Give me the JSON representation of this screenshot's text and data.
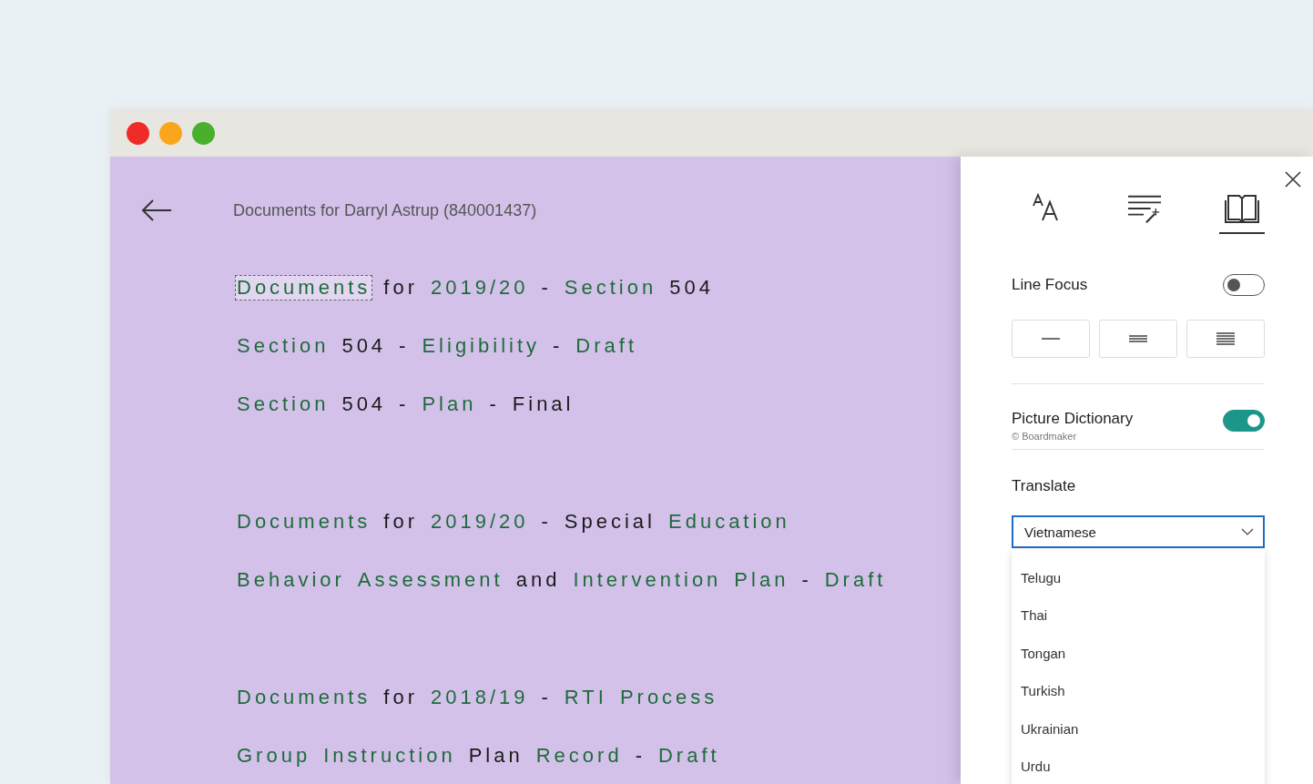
{
  "heading": "Documents for Darryl Astrup (840001437)",
  "groups": [
    [
      {
        "words": [
          {
            "text": "Documents",
            "color": "#1e6b3a",
            "focused": true
          },
          {
            "text": "for",
            "color": "#1a1a1a",
            "focused": false
          },
          {
            "text": "2019/20",
            "color": "#1e6b3a",
            "focused": false
          },
          {
            "text": "-",
            "color": "#1a1a1a",
            "focused": false
          },
          {
            "text": "Section",
            "color": "#1e6b3a",
            "focused": false
          },
          {
            "text": "504",
            "color": "#1a1a1a",
            "focused": false
          }
        ]
      },
      {
        "words": [
          {
            "text": "Section",
            "color": "#1e6b3a",
            "focused": false
          },
          {
            "text": "504",
            "color": "#1a1a1a",
            "focused": false
          },
          {
            "text": "-",
            "color": "#1a1a1a",
            "focused": false
          },
          {
            "text": "Eligibility",
            "color": "#1e6b3a",
            "focused": false
          },
          {
            "text": "-",
            "color": "#1a1a1a",
            "focused": false
          },
          {
            "text": "Draft",
            "color": "#1e6b3a",
            "focused": false
          }
        ]
      },
      {
        "words": [
          {
            "text": "Section",
            "color": "#1e6b3a",
            "focused": false
          },
          {
            "text": "504",
            "color": "#1a1a1a",
            "focused": false
          },
          {
            "text": "-",
            "color": "#1a1a1a",
            "focused": false
          },
          {
            "text": "Plan",
            "color": "#1e6b3a",
            "focused": false
          },
          {
            "text": "-",
            "color": "#1a1a1a",
            "focused": false
          },
          {
            "text": "Final",
            "color": "#1a1a1a",
            "focused": false
          }
        ]
      }
    ],
    [
      {
        "words": [
          {
            "text": "Documents",
            "color": "#1e6b3a",
            "focused": false
          },
          {
            "text": "for",
            "color": "#1a1a1a",
            "focused": false
          },
          {
            "text": "2019/20",
            "color": "#1e6b3a",
            "focused": false
          },
          {
            "text": "-",
            "color": "#1a1a1a",
            "focused": false
          },
          {
            "text": "Special",
            "color": "#1a1a1a",
            "focused": false
          },
          {
            "text": "Education",
            "color": "#1e6b3a",
            "focused": false
          }
        ]
      },
      {
        "words": [
          {
            "text": "Behavior",
            "color": "#1e6b3a",
            "focused": false
          },
          {
            "text": "Assessment",
            "color": "#1e6b3a",
            "focused": false
          },
          {
            "text": "and",
            "color": "#1a1a1a",
            "focused": false
          },
          {
            "text": "Intervention",
            "color": "#1e6b3a",
            "focused": false
          },
          {
            "text": "Plan",
            "color": "#1e6b3a",
            "focused": false
          },
          {
            "text": "-",
            "color": "#1a1a1a",
            "focused": false
          },
          {
            "text": "Draft",
            "color": "#1e6b3a",
            "focused": false
          }
        ]
      }
    ],
    [
      {
        "words": [
          {
            "text": "Documents",
            "color": "#1e6b3a",
            "focused": false
          },
          {
            "text": "for",
            "color": "#1a1a1a",
            "focused": false
          },
          {
            "text": "2018/19",
            "color": "#1e6b3a",
            "focused": false
          },
          {
            "text": "-",
            "color": "#1a1a1a",
            "focused": false
          },
          {
            "text": "RTI",
            "color": "#1e6b3a",
            "focused": false
          },
          {
            "text": "Process",
            "color": "#1e6b3a",
            "focused": false
          }
        ]
      },
      {
        "words": [
          {
            "text": "Group",
            "color": "#1e6b3a",
            "focused": false
          },
          {
            "text": "Instruction",
            "color": "#1e6b3a",
            "focused": false
          },
          {
            "text": "Plan",
            "color": "#1a1a1a",
            "focused": false
          },
          {
            "text": "Record",
            "color": "#1e6b3a",
            "focused": false
          },
          {
            "text": "-",
            "color": "#1a1a1a",
            "focused": false
          },
          {
            "text": "Draft",
            "color": "#1e6b3a",
            "focused": false
          }
        ]
      }
    ]
  ],
  "panel": {
    "tabs": [
      {
        "selected": false
      },
      {
        "selected": false
      },
      {
        "selected": true
      }
    ],
    "line_focus": {
      "label": "Line Focus",
      "on": false
    },
    "picture_dictionary": {
      "label": "Picture Dictionary",
      "credit": "© Boardmaker",
      "on": true
    },
    "translate": {
      "label": "Translate",
      "value": "Vietnamese",
      "options": [
        "Telugu",
        "Thai",
        "Tongan",
        "Turkish",
        "Ukrainian",
        "Urdu"
      ]
    }
  }
}
